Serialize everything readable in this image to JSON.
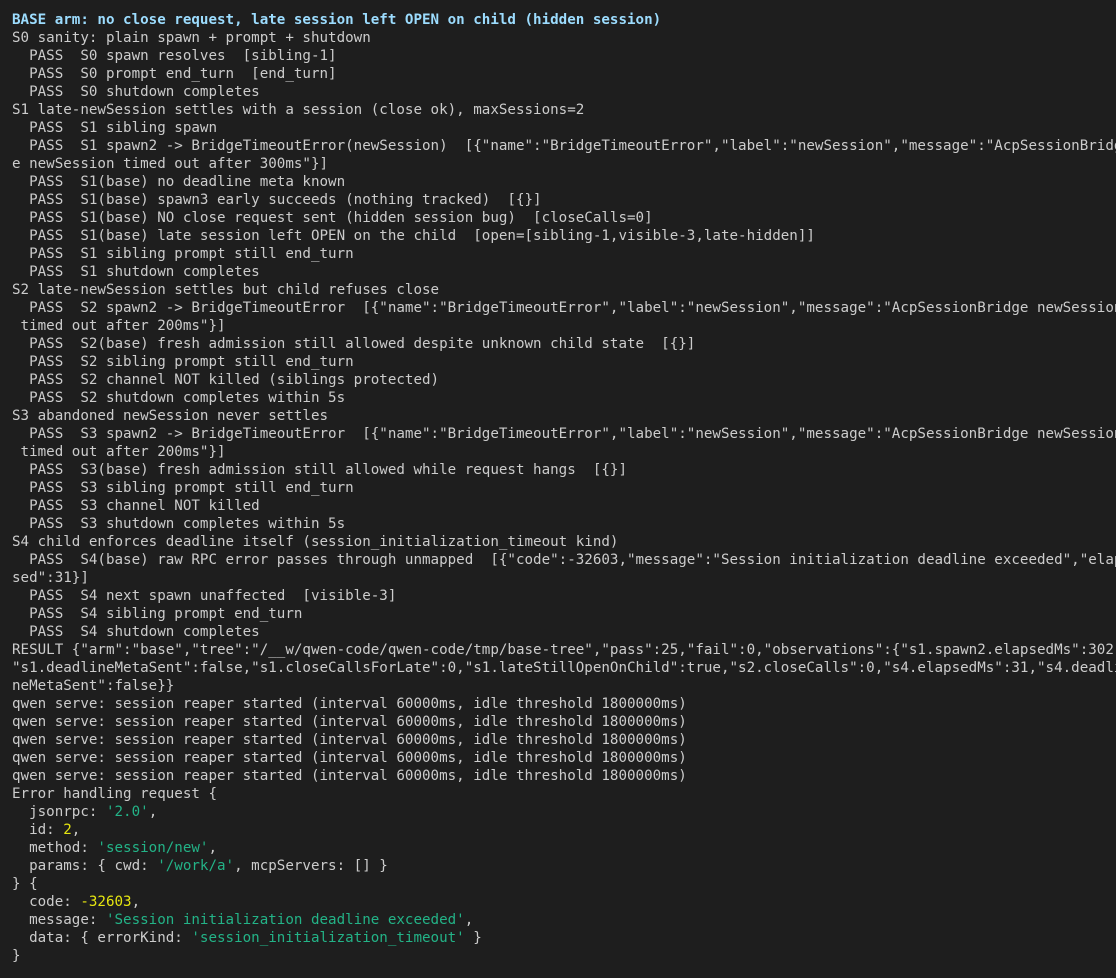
{
  "terminal": {
    "lines": [
      [
        {
          "t": "BASE arm: no close request, late session left OPEN on child (hidden session)",
          "c": "heading"
        }
      ],
      [
        {
          "t": "S0 sanity: plain spawn + prompt + shutdown"
        }
      ],
      [
        {
          "t": "  PASS  S0 spawn resolves  [sibling-1]"
        }
      ],
      [
        {
          "t": "  PASS  S0 prompt end_turn  [end_turn]"
        }
      ],
      [
        {
          "t": "  PASS  S0 shutdown completes"
        }
      ],
      [
        {
          "t": "S1 late-newSession settles with a session (close ok), maxSessions=2"
        }
      ],
      [
        {
          "t": "  PASS  S1 sibling spawn"
        }
      ],
      [
        {
          "t": "  PASS  S1 spawn2 -> BridgeTimeoutError(newSession)  [{\"name\":\"BridgeTimeoutError\",\"label\":\"newSession\",\"message\":\"AcpSessionBridg"
        }
      ],
      [
        {
          "t": "e newSession timed out after 300ms\"}]"
        }
      ],
      [
        {
          "t": "  PASS  S1(base) no deadline meta known"
        }
      ],
      [
        {
          "t": "  PASS  S1(base) spawn3 early succeeds (nothing tracked)  [{}]"
        }
      ],
      [
        {
          "t": "  PASS  S1(base) NO close request sent (hidden session bug)  [closeCalls=0]"
        }
      ],
      [
        {
          "t": "  PASS  S1(base) late session left OPEN on the child  [open=[sibling-1,visible-3,late-hidden]]"
        }
      ],
      [
        {
          "t": "  PASS  S1 sibling prompt still end_turn"
        }
      ],
      [
        {
          "t": "  PASS  S1 shutdown completes"
        }
      ],
      [
        {
          "t": "S2 late-newSession settles but child refuses close"
        }
      ],
      [
        {
          "t": "  PASS  S2 spawn2 -> BridgeTimeoutError  [{\"name\":\"BridgeTimeoutError\",\"label\":\"newSession\",\"message\":\"AcpSessionBridge newSession"
        }
      ],
      [
        {
          "t": " timed out after 200ms\"}]"
        }
      ],
      [
        {
          "t": "  PASS  S2(base) fresh admission still allowed despite unknown child state  [{}]"
        }
      ],
      [
        {
          "t": "  PASS  S2 sibling prompt still end_turn"
        }
      ],
      [
        {
          "t": "  PASS  S2 channel NOT killed (siblings protected)"
        }
      ],
      [
        {
          "t": "  PASS  S2 shutdown completes within 5s"
        }
      ],
      [
        {
          "t": "S3 abandoned newSession never settles"
        }
      ],
      [
        {
          "t": "  PASS  S3 spawn2 -> BridgeTimeoutError  [{\"name\":\"BridgeTimeoutError\",\"label\":\"newSession\",\"message\":\"AcpSessionBridge newSession"
        }
      ],
      [
        {
          "t": " timed out after 200ms\"}]"
        }
      ],
      [
        {
          "t": "  PASS  S3(base) fresh admission still allowed while request hangs  [{}]"
        }
      ],
      [
        {
          "t": "  PASS  S3 sibling prompt still end_turn"
        }
      ],
      [
        {
          "t": "  PASS  S3 channel NOT killed"
        }
      ],
      [
        {
          "t": "  PASS  S3 shutdown completes within 5s"
        }
      ],
      [
        {
          "t": "S4 child enforces deadline itself (session_initialization_timeout kind)"
        }
      ],
      [
        {
          "t": "  PASS  S4(base) raw RPC error passes through unmapped  [{\"code\":-32603,\"message\":\"Session initialization deadline exceeded\",\"elap"
        }
      ],
      [
        {
          "t": "sed\":31}]"
        }
      ],
      [
        {
          "t": "  PASS  S4 next spawn unaffected  [visible-3]"
        }
      ],
      [
        {
          "t": "  PASS  S4 sibling prompt end_turn"
        }
      ],
      [
        {
          "t": "  PASS  S4 shutdown completes"
        }
      ],
      [
        {
          "t": "RESULT {\"arm\":\"base\",\"tree\":\"/__w/qwen-code/qwen-code/tmp/base-tree\",\"pass\":25,\"fail\":0,\"observations\":{\"s1.spawn2.elapsedMs\":302,"
        }
      ],
      [
        {
          "t": "\"s1.deadlineMetaSent\":false,\"s1.closeCallsForLate\":0,\"s1.lateStillOpenOnChild\":true,\"s2.closeCalls\":0,\"s4.elapsedMs\":31,\"s4.deadli"
        }
      ],
      [
        {
          "t": "neMetaSent\":false}}"
        }
      ],
      [
        {
          "t": "qwen serve: session reaper started (interval 60000ms, idle threshold 1800000ms)"
        }
      ],
      [
        {
          "t": "qwen serve: session reaper started (interval 60000ms, idle threshold 1800000ms)"
        }
      ],
      [
        {
          "t": "qwen serve: session reaper started (interval 60000ms, idle threshold 1800000ms)"
        }
      ],
      [
        {
          "t": "qwen serve: session reaper started (interval 60000ms, idle threshold 1800000ms)"
        }
      ],
      [
        {
          "t": "qwen serve: session reaper started (interval 60000ms, idle threshold 1800000ms)"
        }
      ],
      [
        {
          "t": "Error handling request {"
        }
      ],
      [
        {
          "t": "  jsonrpc: "
        },
        {
          "t": "'2.0'",
          "c": "str"
        },
        {
          "t": ","
        }
      ],
      [
        {
          "t": "  id: "
        },
        {
          "t": "2",
          "c": "num"
        },
        {
          "t": ","
        }
      ],
      [
        {
          "t": "  method: "
        },
        {
          "t": "'session/new'",
          "c": "str"
        },
        {
          "t": ","
        }
      ],
      [
        {
          "t": "  params: { cwd: "
        },
        {
          "t": "'/work/a'",
          "c": "str"
        },
        {
          "t": ", mcpServers: [] }"
        }
      ],
      [
        {
          "t": "} {"
        }
      ],
      [
        {
          "t": "  code: "
        },
        {
          "t": "-32603",
          "c": "num"
        },
        {
          "t": ","
        }
      ],
      [
        {
          "t": "  message: "
        },
        {
          "t": "'Session initialization deadline exceeded'",
          "c": "str"
        },
        {
          "t": ","
        }
      ],
      [
        {
          "t": "  data: { errorKind: "
        },
        {
          "t": "'session_initialization_timeout'",
          "c": "str"
        },
        {
          "t": " }"
        }
      ],
      [
        {
          "t": "}"
        }
      ]
    ]
  }
}
